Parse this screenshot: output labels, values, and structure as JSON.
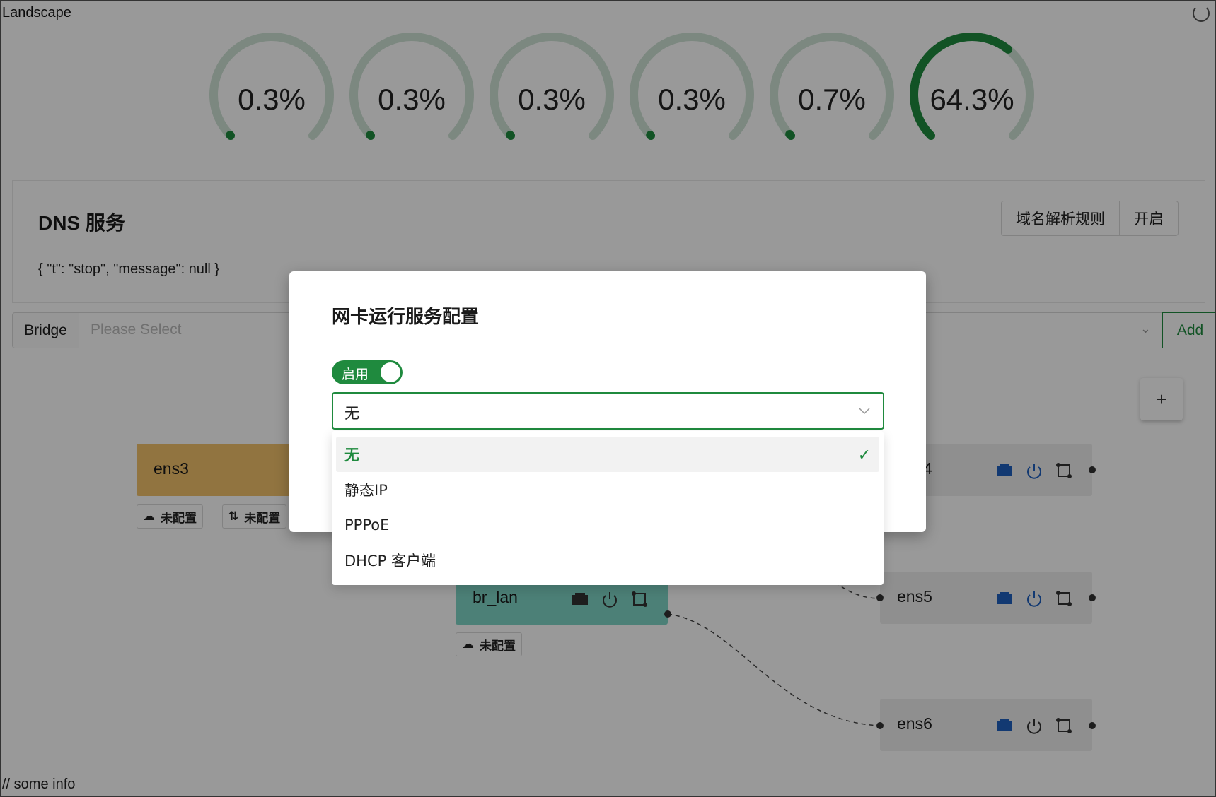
{
  "app": {
    "title": "Landscape"
  },
  "gauges": [
    {
      "label": "0.3%",
      "value": 0.3
    },
    {
      "label": "0.3%",
      "value": 0.3
    },
    {
      "label": "0.3%",
      "value": 0.3
    },
    {
      "label": "0.3%",
      "value": 0.3
    },
    {
      "label": "0.7%",
      "value": 0.7
    },
    {
      "label": "64.3%",
      "value": 64.3
    }
  ],
  "dns": {
    "title": "DNS 服务",
    "status": "{ \"t\": \"stop\", \"message\": null }",
    "rules_button": "域名解析规则",
    "open_button": "开启"
  },
  "bridge": {
    "label": "Bridge",
    "placeholder": "Please Select",
    "add_button": "Add"
  },
  "plus_button": "+",
  "nodes": {
    "ens3": {
      "name": "ens3"
    },
    "ens4": {
      "name": "ens4"
    },
    "br_lan": {
      "name": "br_lan"
    },
    "ens5": {
      "name": "ens5"
    },
    "ens6": {
      "name": "ens6"
    }
  },
  "tags": {
    "ens3_a": "未配置",
    "ens3_b": "未配置",
    "br_lan": "未配置"
  },
  "footer": "// some info",
  "modal": {
    "title": "网卡运行服务配置",
    "switch_label": "启用",
    "select_value": "无",
    "options": [
      "无",
      "静态IP",
      "PPPoE",
      "DHCP 客户端"
    ],
    "selected_option": "无"
  },
  "colors": {
    "accent": "#1f8a3e",
    "gauge_track": "#cfe3d6",
    "node_wan": "#f2c26b",
    "node_lan": "#7fd6c7",
    "node_default": "#efefef",
    "icon_blue": "#1e5fbf"
  }
}
